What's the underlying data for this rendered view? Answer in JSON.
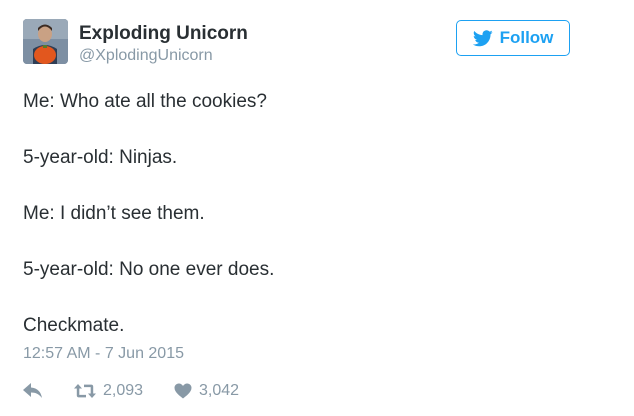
{
  "author": {
    "name": "Exploding Unicorn",
    "handle": "@XplodingUnicorn",
    "avatar_icon": "profile-photo"
  },
  "follow_button": {
    "label": "Follow",
    "icon": "twitter-bird-icon",
    "color": "#1da1f2"
  },
  "tweet": {
    "lines": [
      "Me: Who ate all the cookies?",
      "5-year-old: Ninjas.",
      "Me: I didn’t see them.",
      "5-year-old: No one ever does.",
      "Checkmate."
    ],
    "timestamp": "12:57 AM - 7 Jun 2015"
  },
  "actions": {
    "reply_icon": "reply-icon",
    "retweet_icon": "retweet-icon",
    "retweet_count": "2,093",
    "like_icon": "heart-icon",
    "like_count": "3,042"
  },
  "colors": {
    "text": "#292f33",
    "muted": "#8899a6",
    "accent": "#1da1f2"
  }
}
